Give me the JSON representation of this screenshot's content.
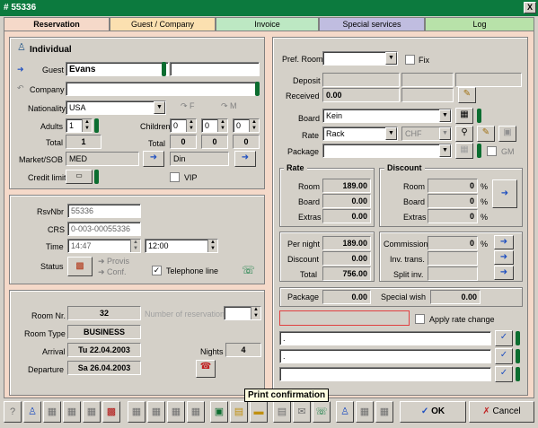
{
  "window": {
    "title": "# 55336",
    "close": "X"
  },
  "tabs": [
    "Reservation",
    "Guest / Company",
    "Invoice",
    "Special services",
    "Log"
  ],
  "guest_panel": {
    "header": "Individual",
    "guest_label": "Guest",
    "guest_value": "Evans",
    "guest_value2": "",
    "company_label": "Company",
    "company_value": "",
    "nationality_label": "Nationality",
    "nationality_value": "USA",
    "f_label": "F",
    "m_label": "M",
    "adults_label": "Adults",
    "adults_value": "1",
    "children_label": "Children",
    "children_values": [
      "0",
      "0",
      "0"
    ],
    "total_label": "Total",
    "total_adults": "1",
    "total2_label": "Total",
    "total_children": [
      "0",
      "0",
      "0"
    ],
    "market_label": "Market/SOB",
    "market_value": "MED",
    "sob_value": "Din",
    "credit_label": "Credit limit",
    "vip_label": "VIP"
  },
  "rsv_panel": {
    "rsvnbr_label": "RsvNbr",
    "rsvnbr_value": "55336",
    "crs_label": "CRS",
    "crs_value": "0-003-00055336",
    "time_label": "Time",
    "time_value": "14:47",
    "time_value2": "12:00",
    "status_label": "Status",
    "provis_label": "Provis",
    "conf_label": "Conf.",
    "telephone_label": "Telephone line"
  },
  "room_panel": {
    "room_nr_label": "Room Nr.",
    "room_nr_value": "32",
    "num_res_label": "Number of reservation",
    "room_type_label": "Room Type",
    "room_type_value": "BUSINESS",
    "arrival_label": "Arrival",
    "arrival_value": "Tu 22.04.2003",
    "nights_label": "Nights",
    "nights_value": "4",
    "departure_label": "Departure",
    "departure_value": "Sa 26.04.2003"
  },
  "right": {
    "pref_room_label": "Pref. Room",
    "fix_label": "Fix",
    "deposit_label": "Deposit",
    "received_label": "Received",
    "received_value": "0.00",
    "board_label": "Board",
    "board_value": "Kein",
    "rate_label": "Rate",
    "rate_value": "Rack",
    "currency_value": "CHF",
    "gm_label": "GM",
    "package_label": "Package",
    "rate_section": {
      "title": "Rate",
      "room_label": "Room",
      "room_value": "189.00",
      "board_label": "Board",
      "board_value": "0.00",
      "extras_label": "Extras",
      "extras_value": "0.00"
    },
    "discount_section": {
      "title": "Discount",
      "room_label": "Room",
      "room_value": "0",
      "board_label": "Board",
      "board_value": "0",
      "extras_label": "Extras",
      "extras_value": "0",
      "pct": "%"
    },
    "pernight_label": "Per night",
    "pernight_value": "189.00",
    "discount_label": "Discount",
    "discount_value": "0.00",
    "total_label": "Total",
    "total_value": "756.00",
    "commission_label": "Commission",
    "commission_value": "0",
    "invtrans_label": "Inv. trans.",
    "splitinv_label": "Split inv.",
    "package2_label": "Package",
    "package2_value": "0.00",
    "special_label": "Special wish",
    "special_value": "0.00",
    "apply_label": "Apply rate change",
    "note1": ".",
    "note2": ".",
    "note3": ""
  },
  "toolbar": {
    "ok": "OK",
    "cancel": "Cancel",
    "tooltip": "Print confirmation"
  },
  "colors": {
    "title": "#0c7a3e",
    "tab_active": "#f5d9c9",
    "green_bar": "#0c6d30"
  }
}
